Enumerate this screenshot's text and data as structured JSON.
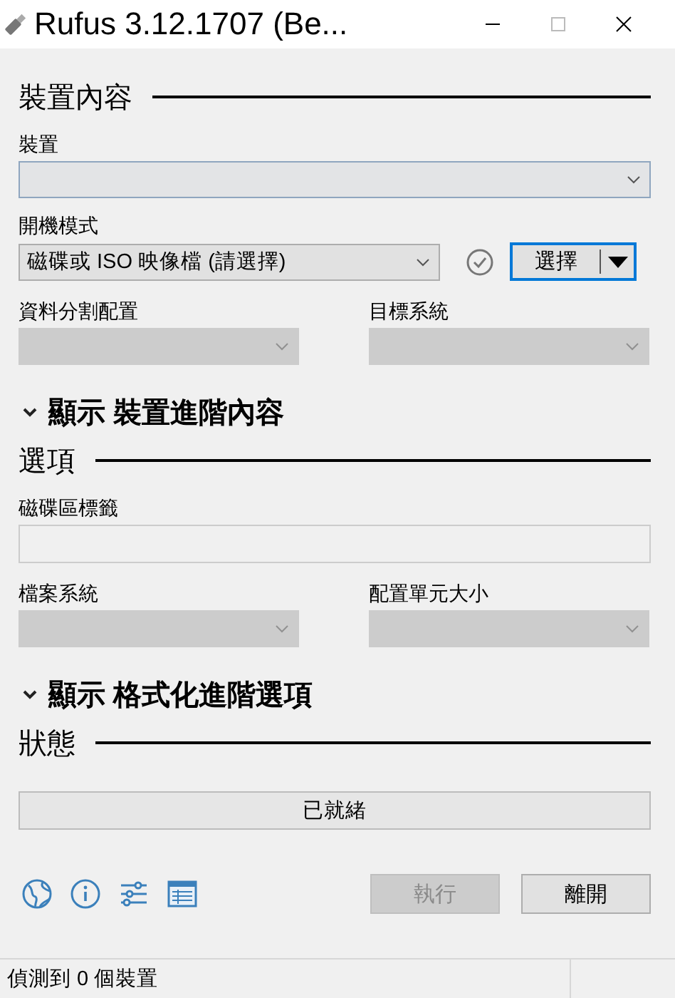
{
  "window": {
    "title": "Rufus 3.12.1707 (Be..."
  },
  "drive_properties": {
    "heading": "裝置內容",
    "device": {
      "label": "裝置",
      "disabled": false
    },
    "boot_selection": {
      "label": "開機模式",
      "value": "磁碟或 ISO 映像檔 (請選擇)",
      "select_button": "選擇"
    },
    "partition_scheme": {
      "label": "資料分割配置",
      "disabled": true
    },
    "target_system": {
      "label": "目標系統",
      "disabled": true
    },
    "advanced_toggle": {
      "label": "顯示 裝置進階內容",
      "expanded": false
    }
  },
  "format_options": {
    "heading": "選項",
    "volume_label": {
      "label": "磁碟區標籤",
      "disabled": true
    },
    "file_system": {
      "label": "檔案系統",
      "disabled": true
    },
    "cluster_size": {
      "label": "配置單元大小",
      "disabled": true
    },
    "advanced_toggle": {
      "label": "顯示 格式化進階選項",
      "expanded": false
    }
  },
  "status": {
    "heading": "狀態",
    "progress": {
      "text": "已就緒",
      "level": 0
    }
  },
  "buttons": [
    {
      "label": "執行",
      "disabled": true
    },
    {
      "label": "離開",
      "disabled": false
    }
  ],
  "status_bar": {
    "text": "偵測到 0 個裝置"
  }
}
